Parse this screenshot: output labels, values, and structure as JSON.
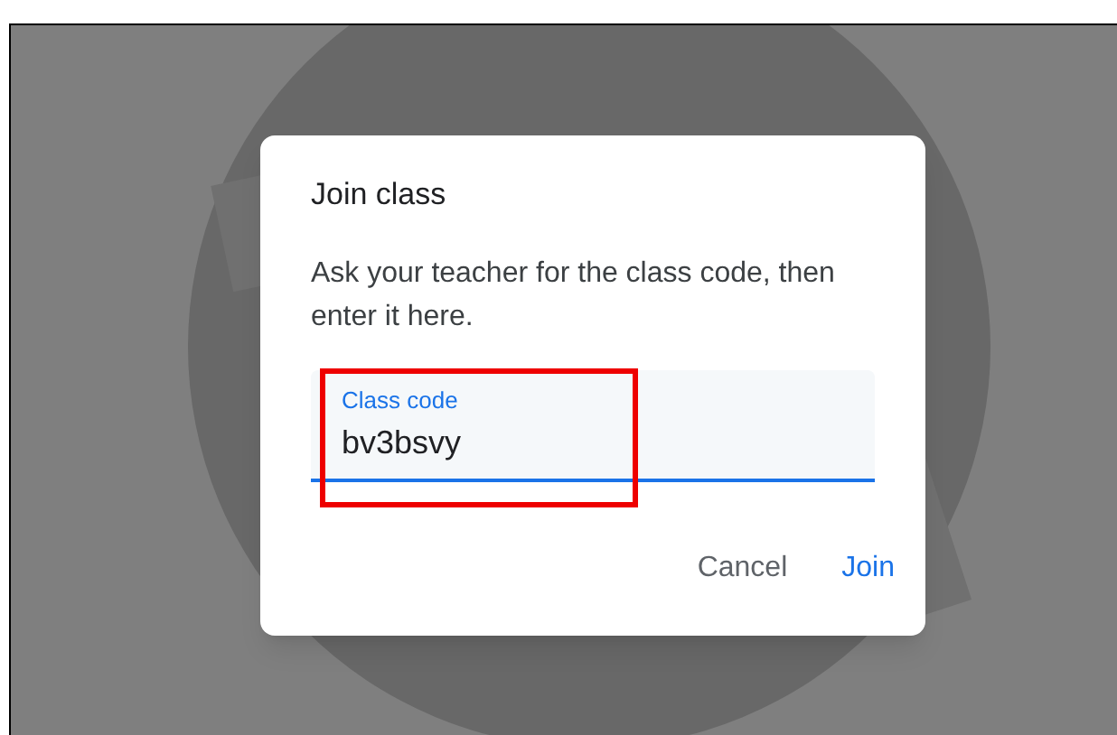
{
  "dialog": {
    "title": "Join class",
    "message": "Ask your teacher for the class code, then enter it here.",
    "field": {
      "label": "Class code",
      "value": "bv3bsvy",
      "focused": true
    },
    "buttons": [
      {
        "label": "Cancel",
        "kind": "secondary"
      },
      {
        "label": "Join",
        "kind": "primary"
      }
    ]
  }
}
